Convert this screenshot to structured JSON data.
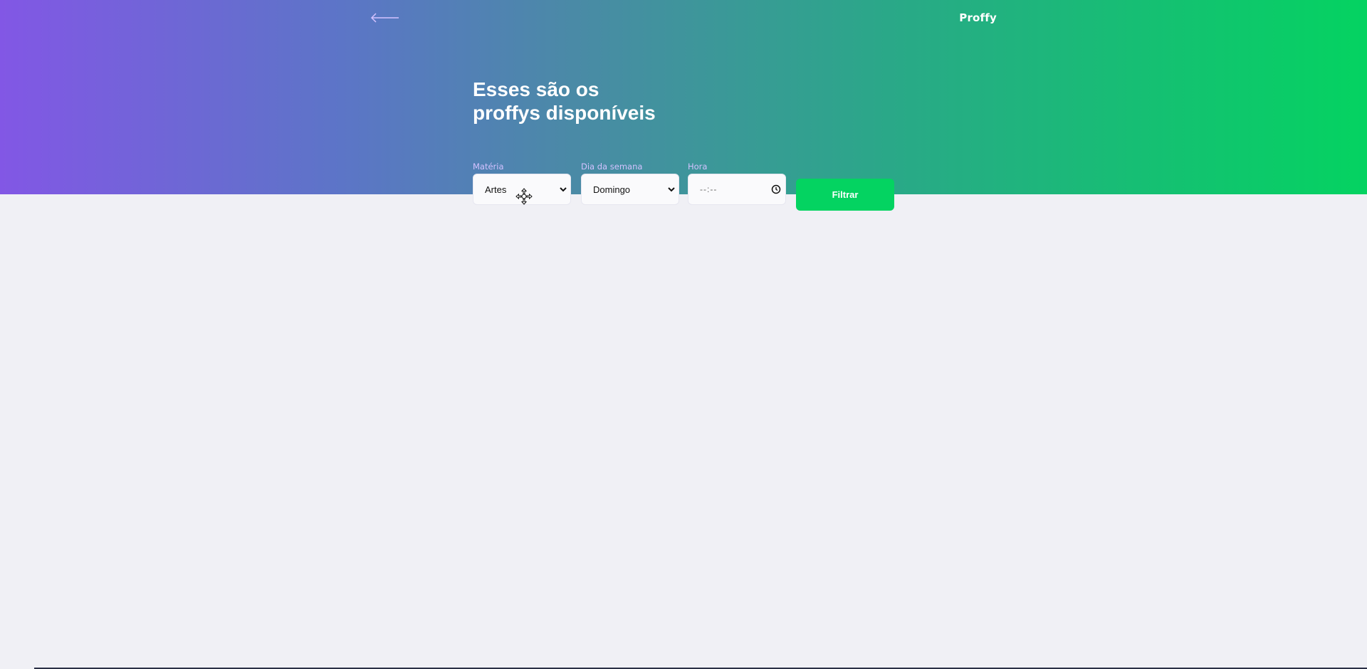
{
  "header": {
    "back_icon": "arrow-left-icon",
    "logo_text": "Proffy",
    "title_line1": "Esses são os",
    "title_line2": "proffys disponíveis"
  },
  "filters": {
    "subject": {
      "label": "Matéria",
      "value": "Artes",
      "icon": "chevron-down-icon"
    },
    "weekday": {
      "label": "Dia da semana",
      "value": "Domingo",
      "icon": "chevron-down-icon"
    },
    "time": {
      "label": "Hora",
      "value": "--:--",
      "icon": "clock-icon"
    },
    "submit_label": "Filtrar"
  },
  "colors": {
    "gradient_start": "#8257e5",
    "gradient_end": "#04d361",
    "button": "#04d361",
    "background": "#f0f0f5",
    "label": "#d4c2ff"
  },
  "cursor_icon": "move-cursor-icon"
}
